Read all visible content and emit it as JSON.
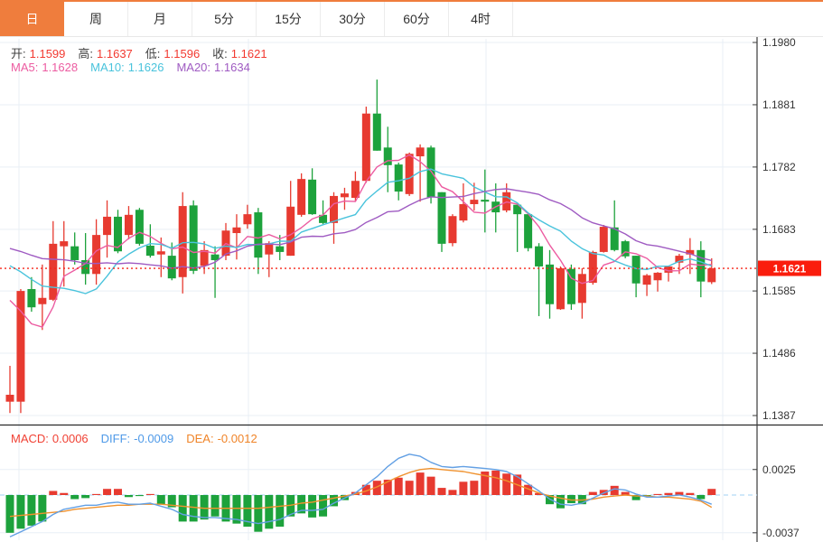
{
  "tabs": {
    "items": [
      {
        "label": "日",
        "active": true
      },
      {
        "label": "周",
        "active": false
      },
      {
        "label": "月",
        "active": false
      },
      {
        "label": "5分",
        "active": false
      },
      {
        "label": "15分",
        "active": false
      },
      {
        "label": "30分",
        "active": false
      },
      {
        "label": "60分",
        "active": false
      },
      {
        "label": "4时",
        "active": false
      }
    ]
  },
  "ohlc": {
    "open_label": "开:",
    "open": "1.1599",
    "high_label": "高:",
    "high": "1.1637",
    "low_label": "低:",
    "low": "1.1596",
    "close_label": "收:",
    "close": "1.1621"
  },
  "ma_legend": {
    "ma5_label": "MA5:",
    "ma5": "1.1628",
    "ma10_label": "MA10:",
    "ma10": "1.1626",
    "ma20_label": "MA20:",
    "ma20": "1.1634"
  },
  "macd_legend": {
    "macd_label": "MACD:",
    "macd": "0.0006",
    "diff_label": "DIFF:",
    "diff": "-0.0009",
    "dea_label": "DEA:",
    "dea": "-0.0012"
  },
  "price_axis": {
    "ticks": [
      "1.1980",
      "1.1881",
      "1.1782",
      "1.1683",
      "1.1585",
      "1.1486",
      "1.1387"
    ],
    "last_price": "1.1621"
  },
  "macd_axis": {
    "ticks": [
      "0.0025",
      "-0.0037"
    ]
  },
  "colors": {
    "up": "#e73a30",
    "down": "#1da23c",
    "ma5": "#ec5ca1",
    "ma10": "#49c3dc",
    "ma20": "#9f5bc2",
    "diff": "#63a0e4",
    "dea": "#f0922e",
    "price_line": "#f5261a",
    "badge": "#fa1d0d",
    "grid": "#e9eff5",
    "axis": "#3a3a3a",
    "zero_dash": "#b5d9f5",
    "tab_accent": "#ef7d3d"
  },
  "chart_data": [
    {
      "type": "candlestick",
      "title": "price-panel",
      "ylim": [
        1.1387,
        1.198
      ],
      "y_axis_ticks": [
        1.198,
        1.1881,
        1.1782,
        1.1683,
        1.1585,
        1.1486,
        1.1387
      ],
      "grid": true,
      "last_price": 1.1621,
      "ohlc_last": {
        "open": 1.1599,
        "high": 1.1637,
        "low": 1.1596,
        "close": 1.1621
      },
      "ma_periods": [
        5,
        10,
        20
      ],
      "ma_last": {
        "ma5": 1.1628,
        "ma10": 1.1626,
        "ma20": 1.1634
      },
      "ma_prehistory_closes": [
        1.168,
        1.168,
        1.168,
        1.168,
        1.168,
        1.168,
        1.168,
        1.168,
        1.168,
        1.168,
        1.168,
        1.168,
        1.168,
        1.168,
        1.168,
        1.167,
        1.166,
        1.16,
        1.15
      ],
      "candles_format": [
        "open",
        "high",
        "low",
        "close"
      ],
      "candles": [
        [
          1.1409,
          1.1466,
          1.1391,
          1.142
        ],
        [
          1.1409,
          1.1588,
          1.1391,
          1.1585
        ],
        [
          1.1588,
          1.1607,
          1.1552,
          1.1559
        ],
        [
          1.1564,
          1.1627,
          1.1523,
          1.1574
        ],
        [
          1.1571,
          1.1696,
          1.1569,
          1.166
        ],
        [
          1.1656,
          1.1696,
          1.1592,
          1.1664
        ],
        [
          1.1656,
          1.1678,
          1.1627,
          1.1634
        ],
        [
          1.1634,
          1.1677,
          1.1595,
          1.1612
        ],
        [
          1.1612,
          1.1699,
          1.1595,
          1.1674
        ],
        [
          1.1674,
          1.1729,
          1.1638,
          1.1703
        ],
        [
          1.1703,
          1.1714,
          1.1645,
          1.1648
        ],
        [
          1.1674,
          1.172,
          1.1667,
          1.1706
        ],
        [
          1.1714,
          1.1717,
          1.1657,
          1.166
        ],
        [
          1.1657,
          1.1691,
          1.1638,
          1.1641
        ],
        [
          1.1643,
          1.167,
          1.1607,
          1.1648
        ],
        [
          1.1641,
          1.1662,
          1.1602,
          1.1605
        ],
        [
          1.1607,
          1.1742,
          1.1581,
          1.172
        ],
        [
          1.1721,
          1.1729,
          1.1612,
          1.1617
        ],
        [
          1.1625,
          1.1664,
          1.1612,
          1.165
        ],
        [
          1.1643,
          1.1656,
          1.1574,
          1.1634
        ],
        [
          1.1641,
          1.1693,
          1.1634,
          1.1681
        ],
        [
          1.1677,
          1.1707,
          1.1635,
          1.1686
        ],
        [
          1.1691,
          1.1722,
          1.1684,
          1.1707
        ],
        [
          1.171,
          1.1717,
          1.1612,
          1.1638
        ],
        [
          1.1643,
          1.1664,
          1.1607,
          1.1661
        ],
        [
          1.1656,
          1.1674,
          1.1634,
          1.1647
        ],
        [
          1.1641,
          1.176,
          1.1641,
          1.1719
        ],
        [
          1.1706,
          1.1772,
          1.1703,
          1.1763
        ],
        [
          1.1762,
          1.178,
          1.1706,
          1.1707
        ],
        [
          1.1706,
          1.1729,
          1.1691,
          1.1693
        ],
        [
          1.1693,
          1.1742,
          1.166,
          1.1736
        ],
        [
          1.1734,
          1.1749,
          1.1714,
          1.174
        ],
        [
          1.1733,
          1.1775,
          1.1727,
          1.176
        ],
        [
          1.176,
          1.1878,
          1.1757,
          1.1867
        ],
        [
          1.1867,
          1.1921,
          1.1808,
          1.1808
        ],
        [
          1.1813,
          1.1846,
          1.1742,
          1.1785
        ],
        [
          1.1786,
          1.1789,
          1.1729,
          1.1743
        ],
        [
          1.1739,
          1.1805,
          1.1736,
          1.1803
        ],
        [
          1.1799,
          1.1818,
          1.1727,
          1.1813
        ],
        [
          1.1813,
          1.1816,
          1.1724,
          1.1734
        ],
        [
          1.1742,
          1.1742,
          1.1647,
          1.166
        ],
        [
          1.1661,
          1.1707,
          1.1656,
          1.1704
        ],
        [
          1.1697,
          1.1756,
          1.1694,
          1.1723
        ],
        [
          1.1723,
          1.1757,
          1.1713,
          1.173
        ],
        [
          1.173,
          1.1778,
          1.1678,
          1.1727
        ],
        [
          1.1727,
          1.1756,
          1.1678,
          1.171
        ],
        [
          1.1713,
          1.1756,
          1.171,
          1.1742
        ],
        [
          1.1722,
          1.1724,
          1.1647,
          1.1707
        ],
        [
          1.1707,
          1.1709,
          1.1648,
          1.1653
        ],
        [
          1.1656,
          1.1661,
          1.1545,
          1.1624
        ],
        [
          1.1627,
          1.165,
          1.1541,
          1.1564
        ],
        [
          1.1556,
          1.1624,
          1.1555,
          1.1621
        ],
        [
          1.162,
          1.1627,
          1.1555,
          1.1564
        ],
        [
          1.1566,
          1.1621,
          1.1541,
          1.1612
        ],
        [
          1.1598,
          1.1649,
          1.1595,
          1.1647
        ],
        [
          1.1647,
          1.169,
          1.1646,
          1.1687
        ],
        [
          1.1686,
          1.1729,
          1.1648,
          1.165
        ],
        [
          1.1664,
          1.1666,
          1.1637,
          1.164
        ],
        [
          1.1641,
          1.1641,
          1.1575,
          1.1597
        ],
        [
          1.1595,
          1.1612,
          1.1577,
          1.161
        ],
        [
          1.1602,
          1.1615,
          1.1584,
          1.1614
        ],
        [
          1.1614,
          1.1625,
          1.16,
          1.1624
        ],
        [
          1.163,
          1.1644,
          1.1612,
          1.1641
        ],
        [
          1.1643,
          1.1669,
          1.1612,
          1.165
        ],
        [
          1.165,
          1.1664,
          1.1575,
          1.16
        ],
        [
          1.1599,
          1.1637,
          1.1596,
          1.1621
        ]
      ]
    },
    {
      "type": "bar",
      "title": "macd-panel",
      "y_axis_ticks": [
        0.0025,
        -0.0037
      ],
      "grid": true,
      "last": {
        "macd": 0.0006,
        "diff": -0.0009,
        "dea": -0.0012
      },
      "macd": [
        -0.0037,
        -0.0033,
        -0.003,
        -0.0026,
        0.0004,
        0.0002,
        -0.0004,
        -0.0003,
        0.0001,
        0.0006,
        0.0006,
        -0.0002,
        -0.0001,
        0.0001,
        -0.0009,
        -0.0012,
        -0.0026,
        -0.0026,
        -0.0024,
        -0.0021,
        -0.0026,
        -0.0028,
        -0.0031,
        -0.0036,
        -0.0033,
        -0.0031,
        -0.0021,
        -0.0018,
        -0.0022,
        -0.0021,
        -0.0011,
        -0.0005,
        0.0003,
        0.001,
        0.0014,
        0.0015,
        0.0017,
        0.0014,
        0.0022,
        0.0018,
        0.0007,
        0.0005,
        0.0013,
        0.0014,
        0.0023,
        0.0024,
        0.0021,
        0.002,
        0.001,
        0.0002,
        -0.0009,
        -0.0013,
        -0.0008,
        -0.0009,
        0.0003,
        0.0005,
        0.0009,
        0.0003,
        -0.0005,
        -0.0001,
        0.0001,
        0.0002,
        0.0003,
        0.0002,
        -0.0004,
        0.0006
      ],
      "diff": [
        -0.0041,
        -0.0036,
        -0.0031,
        -0.0026,
        -0.0019,
        -0.0014,
        -0.0012,
        -0.001,
        -0.001,
        -0.0008,
        -0.0007,
        -0.0009,
        -0.0009,
        -0.0008,
        -0.0011,
        -0.0014,
        -0.0019,
        -0.0021,
        -0.0022,
        -0.0022,
        -0.0023,
        -0.0024,
        -0.0026,
        -0.0028,
        -0.0026,
        -0.0024,
        -0.0019,
        -0.0015,
        -0.0015,
        -0.0014,
        -0.0008,
        -0.0003,
        0.0002,
        0.001,
        0.0018,
        0.0028,
        0.0036,
        0.004,
        0.0038,
        0.0032,
        0.0028,
        0.0027,
        0.0028,
        0.0027,
        0.0026,
        0.0025,
        0.0023,
        0.0018,
        0.0011,
        0.0004,
        -0.0004,
        -0.0009,
        -0.001,
        -0.0008,
        -0.0003,
        0.0002,
        0.0006,
        0.0005,
        0.0001,
        -0.0002,
        -0.0002,
        -0.0001,
        0,
        -0.0002,
        -0.0005,
        -0.0009
      ],
      "dea": [
        -0.0021,
        -0.002,
        -0.0019,
        -0.0018,
        -0.0017,
        -0.0016,
        -0.0014,
        -0.0013,
        -0.0012,
        -0.0011,
        -0.001,
        -0.001,
        -0.0009,
        -0.0009,
        -0.0009,
        -0.001,
        -0.0011,
        -0.0012,
        -0.0013,
        -0.0013,
        -0.0013,
        -0.0013,
        -0.0013,
        -0.0013,
        -0.0012,
        -0.0011,
        -0.001,
        -0.0008,
        -0.0007,
        -0.0005,
        -0.0003,
        -0.0001,
        0.0001,
        0.0004,
        0.0008,
        0.0013,
        0.0018,
        0.0022,
        0.0025,
        0.0026,
        0.0025,
        0.0024,
        0.0023,
        0.0021,
        0.0019,
        0.0017,
        0.0014,
        0.001,
        0.0006,
        0.0002,
        -0.0001,
        -0.0003,
        -0.0005,
        -0.0005,
        -0.0004,
        -0.0002,
        -0.0001,
        0,
        -0.0001,
        -0.0001,
        -0.0002,
        -0.0002,
        -0.0003,
        -0.0004,
        -0.0006,
        -0.0012
      ]
    }
  ]
}
